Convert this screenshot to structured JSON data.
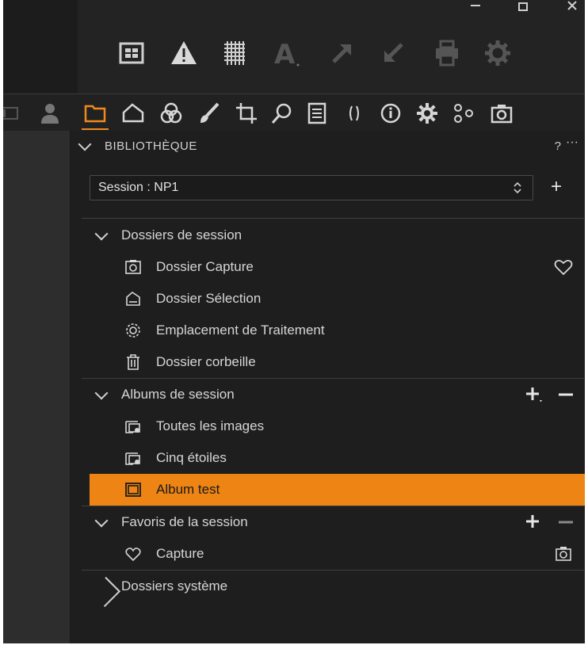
{
  "colors": {
    "accent": "#ee8414",
    "panel_bg": "#1e1e1e",
    "text": "#d6d6d6"
  },
  "window_controls": [
    "minimize-icon",
    "restore-icon",
    "close-icon"
  ],
  "toolbar": {
    "icons": [
      "layout-icon",
      "warning-icon",
      "grid-icon",
      "text-annotation-icon",
      "arrow-up-icon",
      "arrow-down-icon",
      "print-icon",
      "settings-icon"
    ]
  },
  "tool_tabs": {
    "icons": [
      "panel-left-icon",
      "user-icon",
      "folder-icon",
      "capture-icon",
      "color-icon",
      "brush-icon",
      "crop-icon",
      "search-icon",
      "metadata-icon",
      "tether-icon",
      "info-icon",
      "adjust-icon",
      "styles-icon",
      "camera-icon"
    ],
    "active": "folder-icon"
  },
  "panel": {
    "title": "BIBLIOTHÈQUE",
    "help": "?",
    "more": "···",
    "session_select": "Session : NP1",
    "session_add": "+"
  },
  "groups": {
    "session_folders": {
      "label": "Dossiers de session",
      "items": [
        {
          "label": "Dossier Capture",
          "icon": "camera-folder-icon",
          "right_icon": "heart-icon"
        },
        {
          "label": "Dossier Sélection",
          "icon": "selection-folder-icon"
        },
        {
          "label": "Emplacement de Traitement",
          "icon": "processing-gear-icon"
        },
        {
          "label": "Dossier corbeille",
          "icon": "trash-icon"
        }
      ]
    },
    "session_albums": {
      "label": "Albums de session",
      "items": [
        {
          "label": "Toutes les images",
          "icon": "smart-album-icon"
        },
        {
          "label": "Cinq étoiles",
          "icon": "smart-album-icon"
        },
        {
          "label": "Album test",
          "icon": "album-icon",
          "selected": true
        }
      ]
    },
    "session_favorites": {
      "label": "Favoris de la session",
      "items": [
        {
          "label": "Capture",
          "icon": "heart-icon",
          "right_icon": "camera-icon"
        }
      ]
    },
    "system_folders": {
      "label": "Dossiers système"
    }
  }
}
